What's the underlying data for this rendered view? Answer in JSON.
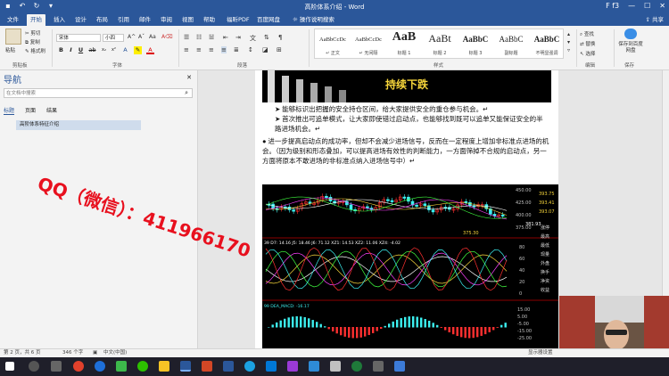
{
  "app": {
    "title": "高阶体系介绍 - Word",
    "window_controls": {
      "minimize": "—",
      "maximize": "☐",
      "close": "✕",
      "account": "F f3"
    }
  },
  "tabs": [
    {
      "label": "文件"
    },
    {
      "label": "开始"
    },
    {
      "label": "插入"
    },
    {
      "label": "设计"
    },
    {
      "label": "布局"
    },
    {
      "label": "引用"
    },
    {
      "label": "邮件"
    },
    {
      "label": "审阅"
    },
    {
      "label": "视图"
    },
    {
      "label": "帮助"
    },
    {
      "label": "福昕PDF"
    },
    {
      "label": "百度网盘"
    },
    {
      "label": "操作说明搜索"
    }
  ],
  "share_label": "共享",
  "ribbon": {
    "clipboard": {
      "paste": "粘贴",
      "cut": "剪切",
      "copy": "复制",
      "format_painter": "格式刷",
      "label": "剪贴板"
    },
    "font": {
      "name": "宋体",
      "size": "小四",
      "label": "字体"
    },
    "paragraph_label": "段落",
    "styles": [
      {
        "sample": "AaBbCcDc",
        "name": "正文"
      },
      {
        "sample": "AaBbCcDc",
        "name": "无间隔"
      },
      {
        "sample": "AaB",
        "name": "标题 1"
      },
      {
        "sample": "AaBt",
        "name": "标题 2"
      },
      {
        "sample": "AaBbC",
        "name": "标题 3"
      },
      {
        "sample": "AaBbC",
        "name": "副标题"
      },
      {
        "sample": "AaBbC",
        "name": "不明显强调"
      }
    ],
    "styles_label": "样式",
    "editing": {
      "find": "查找",
      "replace": "替换",
      "select": "选择",
      "label": "编辑"
    },
    "save": {
      "button": "保存到百度网盘",
      "label": "保存"
    }
  },
  "nav": {
    "title": "导航",
    "search_placeholder": "在文档中搜索",
    "tabs": [
      {
        "label": "标题"
      },
      {
        "label": "页面"
      },
      {
        "label": "结果"
      }
    ],
    "items": [
      {
        "label": "高阶体系特征介绍"
      }
    ]
  },
  "watermark": "QQ（微信）：411966170",
  "document": {
    "header_image_text": "持续下跌",
    "bullets": [
      "能够标识出把握的安全持仓区间，给大家提供安全的重仓参与机会。↵",
      "首次推出可追单模式，让大家即使错过启动点，也能够找到既可以追单又能保证安全的半路进场机会。↵"
    ],
    "main_paragraph": "进一步提高启动点的成功率，但却不会减少进场信号，反而在一定程度上增加非标准点进场的机会。（因为级别和形态叠加，可以提高进场有效性的判断能力，一方面筛掉不合规的启动点，另一方面将原本不敢进场的非标准点纳入进场信号中）↵"
  },
  "chart_data": {
    "type": "line",
    "price_axis_ticks": [
      "450.00",
      "425.00",
      "400.00",
      "375.00"
    ],
    "price_labels": [
      "393.75",
      "393.41",
      "393.07",
      "381.93",
      "375.30"
    ],
    "low_marker": "375.30",
    "indicator_line": "39  D7: 14.16  J5: 18.46  J6: 71.12  XZ1: 14.53  XZ2: 11.06  XZ4: -4.02",
    "indicator_ticks": [
      "80",
      "60",
      "40",
      "20",
      "0"
    ],
    "macd_label": "99  DEA_MACD: -16.17",
    "macd_ticks": [
      "15.00",
      "5.00",
      "-5.00",
      "-15.00",
      "-25.00"
    ],
    "side_labels": [
      "涨停",
      "最高",
      "最低",
      "现量",
      "外盘",
      "换手",
      "净资",
      "收益"
    ]
  },
  "statusbar": {
    "page": "第 2 页，共 6 页",
    "words": "346 个字",
    "lang": "中文(中国)",
    "display": "显示器设置"
  },
  "taskbar": {
    "time": "",
    "date": ""
  },
  "colors": {
    "accent": "#2b579a",
    "watermark": "#e8101e",
    "chart_title": "#f5d43a"
  }
}
